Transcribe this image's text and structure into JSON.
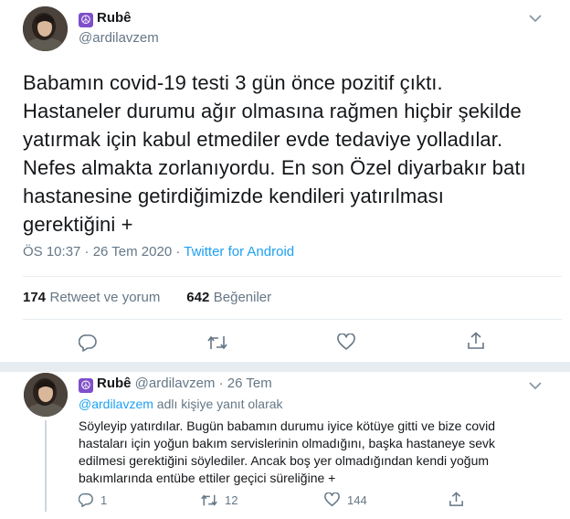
{
  "tweet": {
    "author_name": "Rubê",
    "author_handle": "@ardilavzem",
    "text_lines": [
      "Babamın covid-19 testi 3 gün önce pozitif çıktı.",
      "Hastaneler durumu ağır olmasına rağmen hiçbir şekilde",
      "yatırmak için kabul etmediler evde tedaviye yolladılar.",
      "Nefes almakta zorlanıyordu. En son Özel diyarbakır batı",
      "hastanesine getirdiğimizde kendileri yatırılması",
      "gerektiğini +"
    ],
    "time": "ÖS 10:37 · 26 Tem 2020 · ",
    "source": "Twitter for Android",
    "retweets_count": "174",
    "retweets_label": "Retweet ve yorum",
    "likes_count": "642",
    "likes_label": "Beğeniler"
  },
  "reply": {
    "author_name": "Rubê",
    "author_handle": "@ardilavzem",
    "date": "· 26 Tem",
    "reply_to_handle": "@ardilavzem",
    "reply_to_suffix": " adlı kişiye yanıt olarak",
    "text_lines": [
      "Söyleyip yatırdılar. Bugün babamın durumu iyice kötüye gitti ve bize covid",
      "hastaları için yoğun bakım servislerinin olmadığını, başka hastaneye sevk",
      "edilmesi gerektiğini söylediler. Ancak boş yer olmadığından kendi yoğum",
      "bakımlarında entübe ettiler geçici süreliğine +"
    ],
    "reply_count": "1",
    "retweet_count": "12",
    "like_count": "144"
  },
  "icons": {
    "peace": "☮",
    "chevron": "chevron-down-icon",
    "reply": "reply-icon",
    "retweet": "retweet-icon",
    "like": "heart-icon",
    "share": "share-icon"
  },
  "colors": {
    "accent": "#1da1f2",
    "secondary_text": "#657786",
    "emoji_purple": "#7f4fc9"
  }
}
